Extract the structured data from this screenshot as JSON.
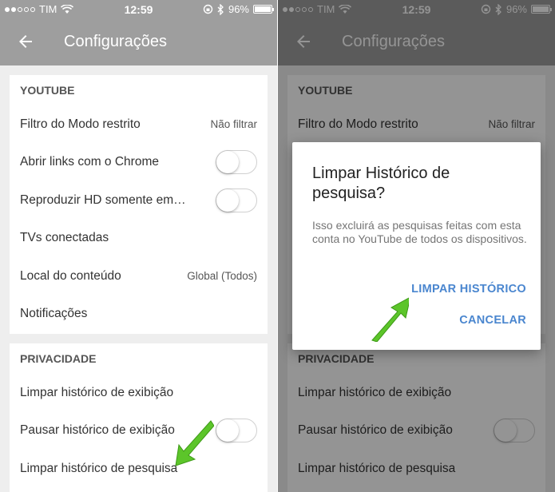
{
  "status_bar": {
    "carrier": "TIM",
    "time": "12:59",
    "battery": "96%",
    "signal_bars": 2,
    "battery_level": 0.96
  },
  "toolbar": {
    "title": "Configurações"
  },
  "youtube_section": {
    "header": "YOUTUBE",
    "rows": [
      {
        "label": "Filtro do Modo restrito",
        "value": "Não filtrar"
      },
      {
        "label": "Abrir links com o Chrome",
        "toggle": false
      },
      {
        "label": "Reproduzir HD somente em…",
        "toggle": false
      },
      {
        "label": "TVs conectadas"
      },
      {
        "label": "Local do conteúdo",
        "value": "Global (Todos)"
      },
      {
        "label": "Notificações"
      }
    ]
  },
  "privacy_section": {
    "header": "PRIVACIDADE",
    "rows": [
      {
        "label": "Limpar histórico de exibição"
      },
      {
        "label": "Pausar histórico de exibição",
        "toggle": false
      },
      {
        "label": "Limpar histórico de pesquisa"
      }
    ]
  },
  "dialog": {
    "title": "Limpar Histórico de pesquisa?",
    "text": "Isso excluirá as pesquisas feitas com esta conta no YouTube de todos os dispositivos.",
    "confirm_label": "LIMPAR HISTÓRICO",
    "cancel_label": "CANCELAR"
  },
  "colors": {
    "toolbar": "#9e9e9e",
    "accent": "#4a86cf",
    "arrow": "#5cc52a",
    "scrim": "rgba(0,0,0,0.42)"
  },
  "icons": {
    "back": "arrow-left-icon",
    "wifi": "wifi-icon",
    "bluetooth": "bluetooth-icon",
    "lock_rotation": "rotation-lock-icon",
    "battery": "battery-icon"
  }
}
